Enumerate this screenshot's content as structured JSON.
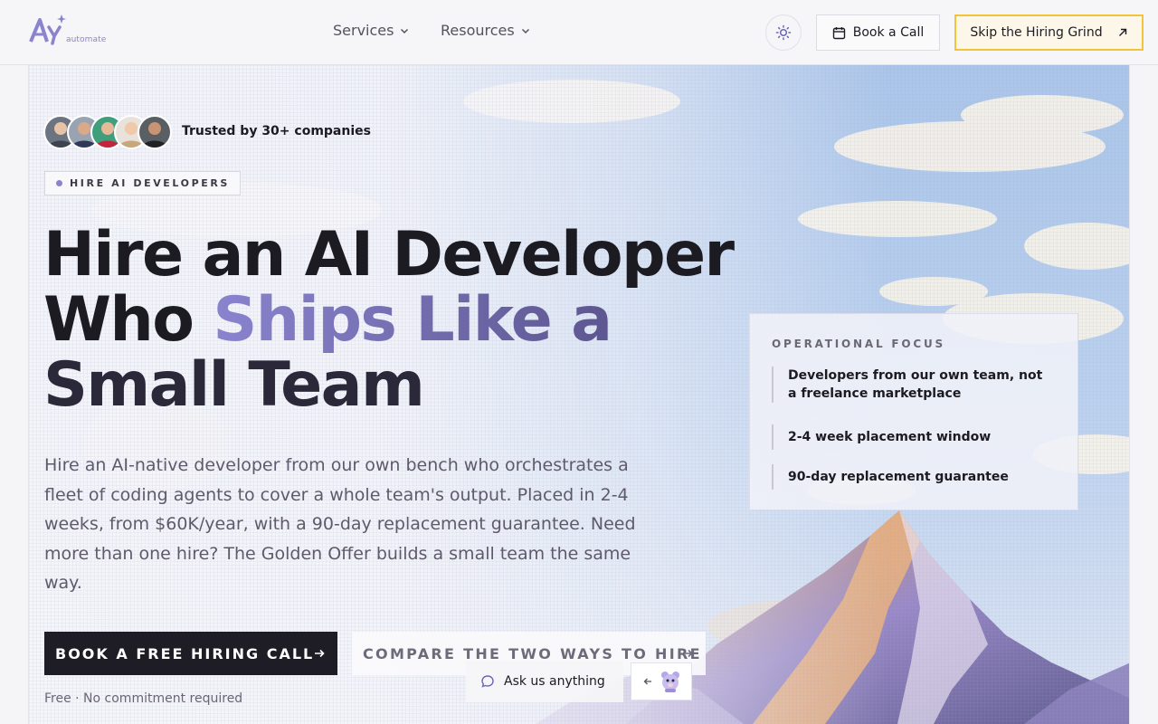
{
  "brand": {
    "logo_text": "automate",
    "accent": "#8a84cf",
    "highlight": "#f2c43c"
  },
  "nav": {
    "items": [
      {
        "label": "Services"
      },
      {
        "label": "Resources"
      }
    ],
    "theme_icon": "sun-icon",
    "book_call_label": "Book a Call",
    "skip_label": "Skip the Hiring Grind"
  },
  "hero": {
    "trusted_text": "Trusted by 30+ companies",
    "eyebrow": "HIRE AI DEVELOPERS",
    "headline": {
      "line1": "Hire an AI Developer",
      "line2_start": "Who ",
      "line2_accent": "Ships Like a",
      "line3": "Small Team"
    },
    "lead": "Hire an AI-native developer from our own bench who orchestrates a fleet of coding agents to cover a whole team's output. Placed in 2-4 weeks, from $60K/year, with a 90-day replacement guarantee. Need more than one hire? The Golden Offer builds a small team the same way.",
    "cta_primary": "BOOK A FREE HIRING CALL",
    "cta_secondary": "COMPARE THE TWO WAYS TO HIRE",
    "cta_note": "Free · No commitment required"
  },
  "focus": {
    "title": "OPERATIONAL FOCUS",
    "items": [
      "Developers from our own team, not a freelance marketplace",
      "2-4 week placement window",
      "90-day replacement guarantee"
    ]
  },
  "chat": {
    "label": "Ask us anything"
  }
}
